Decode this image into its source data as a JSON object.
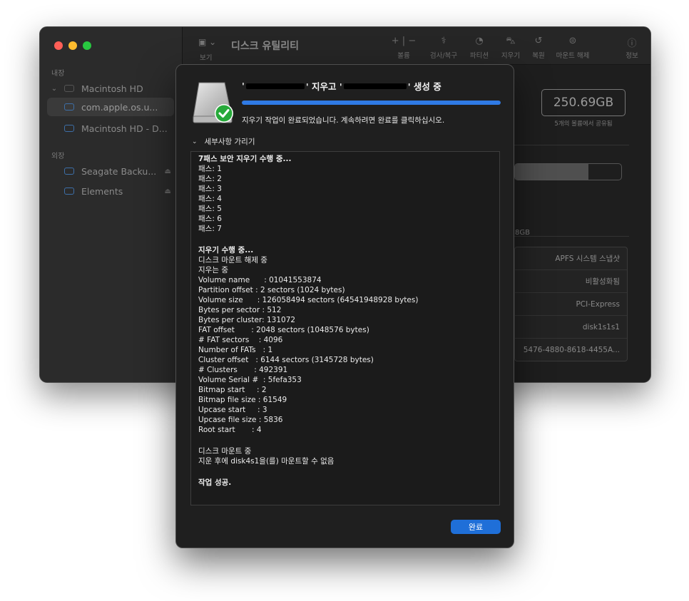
{
  "window": {
    "title": "디스크 유틸리티",
    "toolbar": {
      "view_label": "보기",
      "buttons": [
        {
          "label": "볼륨",
          "icon": "plus-minus-icon"
        },
        {
          "label": "검사/복구",
          "icon": "stethoscope-icon"
        },
        {
          "label": "파티션",
          "icon": "pie-icon"
        },
        {
          "label": "지우기",
          "icon": "erase-icon"
        },
        {
          "label": "복원",
          "icon": "restore-icon"
        },
        {
          "label": "마운트 해제",
          "icon": "unmount-icon"
        },
        {
          "label": "정보",
          "icon": "info-icon"
        }
      ]
    }
  },
  "sidebar": {
    "internal_label": "내장",
    "external_label": "외장",
    "internal_items": [
      {
        "label": "Macintosh HD"
      },
      {
        "label": "com.apple.os.u..."
      },
      {
        "label": "Macintosh HD - D..."
      }
    ],
    "external_items": [
      {
        "label": "Seagate Backu..."
      },
      {
        "label": "Elements"
      }
    ]
  },
  "content": {
    "capacity": "250.69GB",
    "capacity_sub": "5개의 볼륨에서 공유됨",
    "usage_fraction": 0.69,
    "usage_text": "8GB",
    "info_rows": [
      "APFS 시스템 스냅샷",
      "비활성화됨",
      "PCI-Express",
      "disk1s1s1",
      "5476-4880-8618-4455A..."
    ]
  },
  "dialog": {
    "title_part1": "' 지우고 '",
    "title_part2": "' 생성 중",
    "progress": 1.0,
    "message": "지우기 작업이 완료되었습니다. 계속하려면 완료를 클릭하십시오.",
    "details_toggle": "세부사항 가리기",
    "done_button": "완료",
    "log_lines": [
      {
        "text": "7패스 보안 지우기 수행 중...",
        "bold": true
      },
      {
        "text": "패스: 1"
      },
      {
        "text": "패스: 2"
      },
      {
        "text": "패스: 3"
      },
      {
        "text": "패스: 4"
      },
      {
        "text": "패스: 5"
      },
      {
        "text": "패스: 6"
      },
      {
        "text": "패스: 7"
      },
      {
        "text": "",
        "gap": true
      },
      {
        "text": "지우기 수행 중...",
        "bold": true
      },
      {
        "text": "디스크 마운트 해제 중"
      },
      {
        "text": "지우는 중"
      },
      {
        "text": "Volume name      : 01041553874"
      },
      {
        "text": "Partition offset : 2 sectors (1024 bytes)"
      },
      {
        "text": "Volume size      : 126058494 sectors (64541948928 bytes)"
      },
      {
        "text": "Bytes per sector : 512"
      },
      {
        "text": "Bytes per cluster: 131072"
      },
      {
        "text": "FAT offset       : 2048 sectors (1048576 bytes)"
      },
      {
        "text": "# FAT sectors    : 4096"
      },
      {
        "text": "Number of FATs   : 1"
      },
      {
        "text": "Cluster offset   : 6144 sectors (3145728 bytes)"
      },
      {
        "text": "# Clusters       : 492391"
      },
      {
        "text": "Volume Serial #  : 5fefa353"
      },
      {
        "text": "Bitmap start     : 2"
      },
      {
        "text": "Bitmap file size : 61549"
      },
      {
        "text": "Upcase start     : 3"
      },
      {
        "text": "Upcase file size : 5836"
      },
      {
        "text": "Root start       : 4"
      },
      {
        "text": "",
        "gap": true
      },
      {
        "text": "디스크 마운트 중"
      },
      {
        "text": "지운 후에 disk4s1을(를) 마운트할 수 없음"
      },
      {
        "text": "",
        "gap": true
      },
      {
        "text": "작업 성공.",
        "bold": true
      }
    ]
  }
}
